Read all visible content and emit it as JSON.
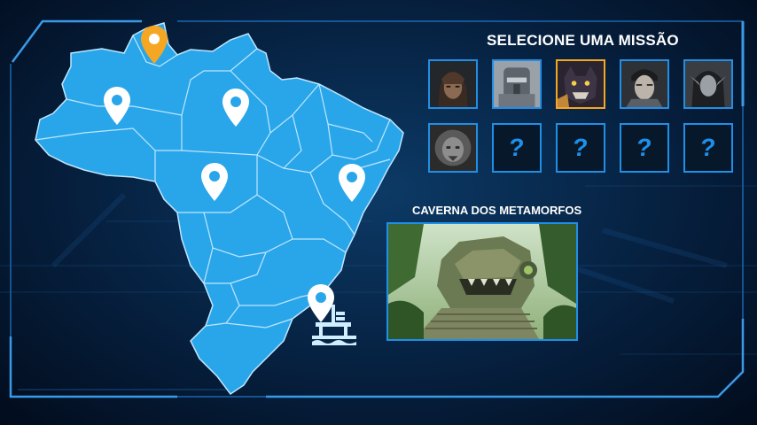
{
  "header": {
    "title": "SELECIONE UMA MISSÃO"
  },
  "colors": {
    "accent": "#1f8fe8",
    "selected": "#f5a623",
    "map_fill": "#29a6ea",
    "map_border": "#bfe6ff"
  },
  "map": {
    "icons": [
      "map-pin-icon",
      "map-pin-icon-selected",
      "oil-platform-icon"
    ]
  },
  "missions": {
    "portraits": [
      {
        "name": "tribal-warrior",
        "state": "unlocked"
      },
      {
        "name": "armored-robot",
        "state": "unlocked"
      },
      {
        "name": "beast-panther",
        "state": "selected"
      },
      {
        "name": "scarred-fighter",
        "state": "unlocked"
      },
      {
        "name": "elf-woman",
        "state": "unlocked"
      },
      {
        "name": "stone-lion",
        "state": "unlocked"
      }
    ],
    "locked": [
      "?",
      "?",
      "?",
      "?"
    ]
  },
  "selected_mission": {
    "name": "CAVERNA DOS METAMORFOS"
  }
}
